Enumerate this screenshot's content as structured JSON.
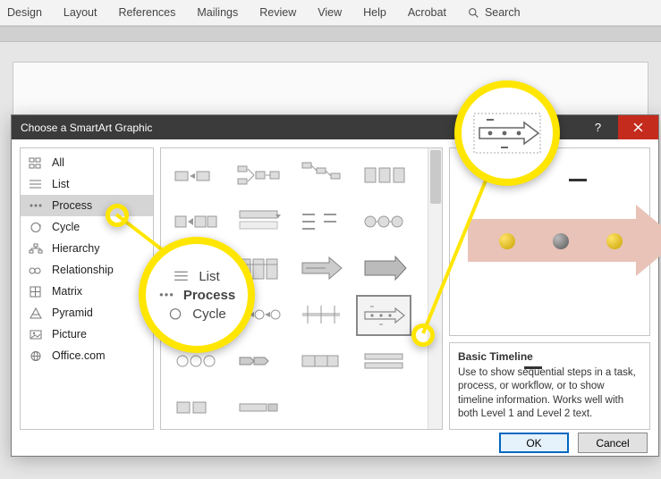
{
  "ribbon": {
    "tabs": [
      "Design",
      "Layout",
      "References",
      "Mailings",
      "Review",
      "View",
      "Help",
      "Acrobat"
    ],
    "search_label": "Search"
  },
  "dialog": {
    "title": "Choose a SmartArt Graphic",
    "categories": [
      {
        "icon": "all",
        "label": "All"
      },
      {
        "icon": "list",
        "label": "List"
      },
      {
        "icon": "process",
        "label": "Process",
        "selected": true
      },
      {
        "icon": "cycle",
        "label": "Cycle"
      },
      {
        "icon": "hierarchy",
        "label": "Hierarchy"
      },
      {
        "icon": "relationship",
        "label": "Relationship"
      },
      {
        "icon": "matrix",
        "label": "Matrix"
      },
      {
        "icon": "pyramid",
        "label": "Pyramid"
      },
      {
        "icon": "picture",
        "label": "Picture"
      },
      {
        "icon": "office",
        "label": "Office.com"
      }
    ],
    "selected_thumb_index": 15,
    "preview": {
      "title": "Basic Timeline",
      "description": "Use to show sequential steps in a task, process, or workflow, or to show timeline information. Works well with both Level 1 and Level 2 text."
    },
    "buttons": {
      "ok": "OK",
      "cancel": "Cancel"
    }
  },
  "zoom_labels": {
    "list": "List",
    "process": "Process",
    "cycle": "Cycle"
  }
}
